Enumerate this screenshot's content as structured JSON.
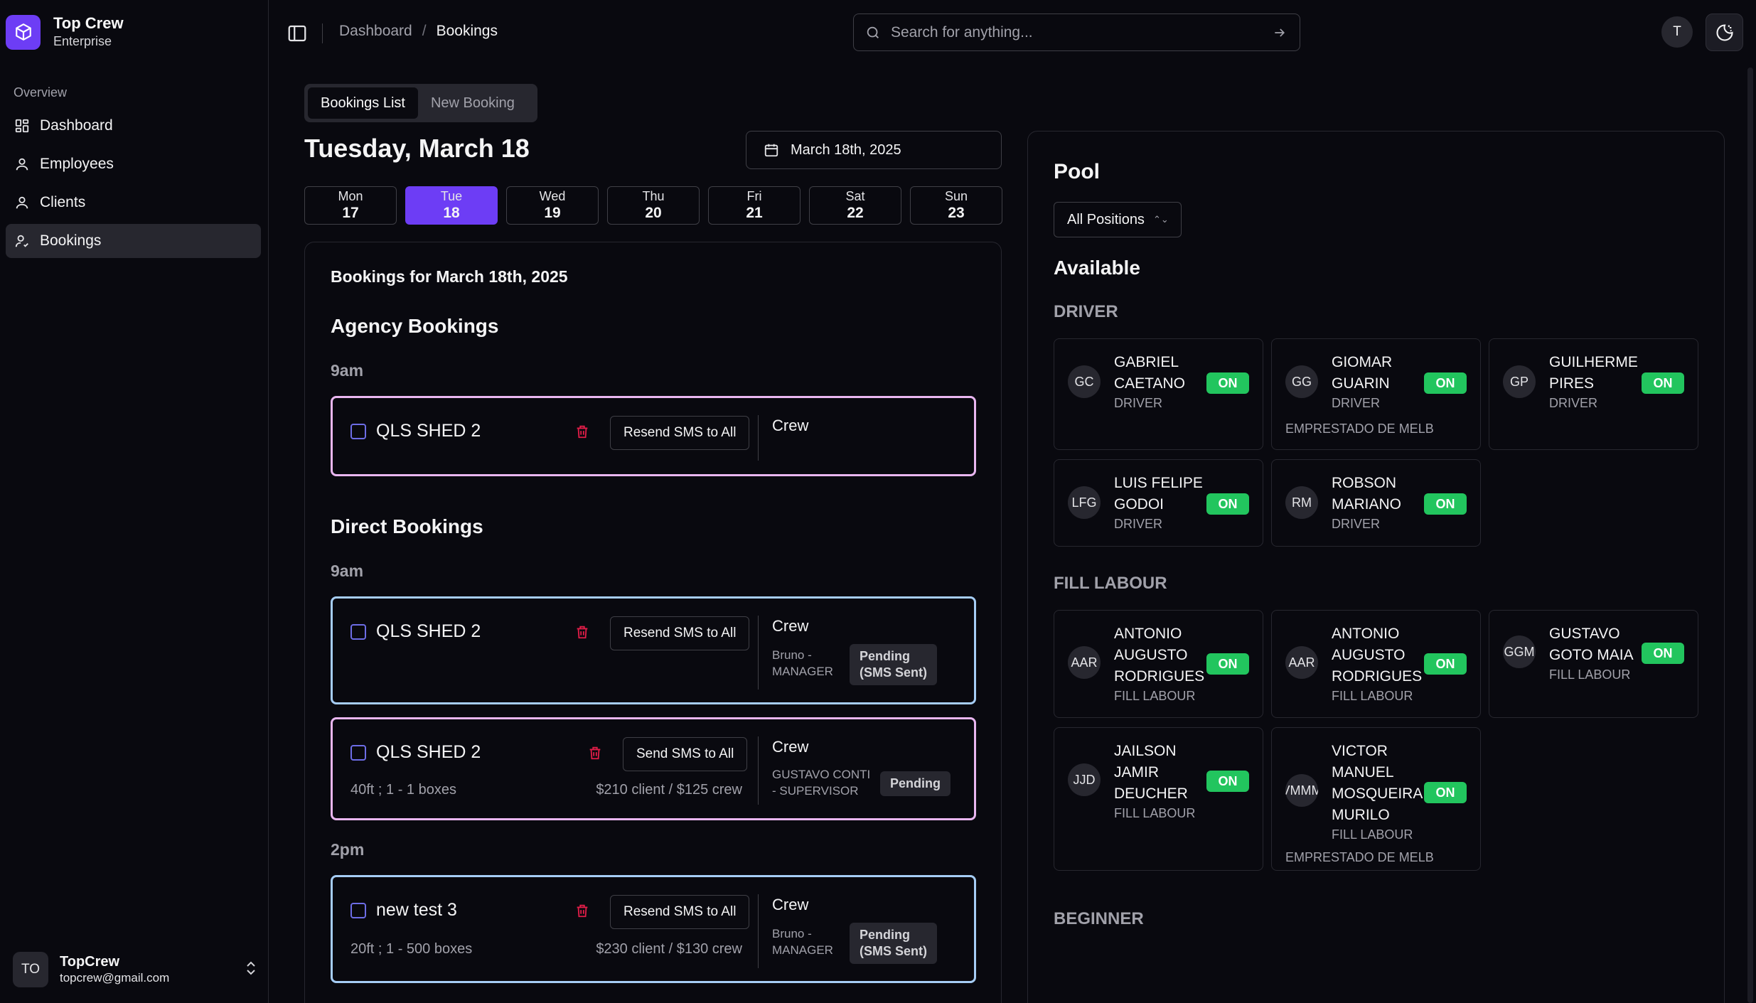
{
  "brand": {
    "name": "Top Crew",
    "plan": "Enterprise"
  },
  "sidebar": {
    "section": "Overview",
    "items": [
      {
        "label": "Dashboard",
        "icon": "dashboard-icon"
      },
      {
        "label": "Employees",
        "icon": "user-icon"
      },
      {
        "label": "Clients",
        "icon": "user-icon"
      },
      {
        "label": "Bookings",
        "icon": "user-check-icon",
        "active": true
      }
    ]
  },
  "user": {
    "initials": "TO",
    "name": "TopCrew",
    "email": "topcrew@gmail.com"
  },
  "topbar": {
    "breadcrumb": [
      "Dashboard",
      "Bookings"
    ],
    "search_placeholder": "Search for anything...",
    "avatar_initial": "T"
  },
  "tabs": {
    "list": "Bookings List",
    "new": "New Booking"
  },
  "date": {
    "title": "Tuesday, March 18",
    "picker": "March 18th, 2025"
  },
  "week": [
    {
      "name": "Mon",
      "num": "17"
    },
    {
      "name": "Tue",
      "num": "18",
      "active": true
    },
    {
      "name": "Wed",
      "num": "19"
    },
    {
      "name": "Thu",
      "num": "20"
    },
    {
      "name": "Fri",
      "num": "21"
    },
    {
      "name": "Sat",
      "num": "22"
    },
    {
      "name": "Sun",
      "num": "23"
    }
  ],
  "bookings": {
    "header": "Bookings for March 18th, 2025",
    "agency_title": "Agency Bookings",
    "direct_title": "Direct Bookings",
    "agency": [
      {
        "time": "9am",
        "name": "QLS SHED 2",
        "sms": "Resend SMS to All",
        "crew": "Crew"
      }
    ],
    "direct": [
      {
        "time": "9am",
        "name": "QLS SHED 2",
        "sms": "Resend SMS to All",
        "crew": "Crew",
        "person": [
          "Bruno -",
          "MANAGER"
        ],
        "status": [
          "Pending",
          "(SMS Sent)"
        ]
      },
      {
        "name": "QLS SHED 2",
        "sms": "Send SMS to All",
        "crew": "Crew",
        "sub": "40ft ; 1 - 1 boxes",
        "price": "$210 client / $125 crew",
        "person": [
          "GUSTAVO CONTI",
          "- SUPERVISOR"
        ],
        "status": [
          "Pending"
        ]
      },
      {
        "time": "2pm",
        "name": "new test 3",
        "sms": "Resend SMS to All",
        "crew": "Crew",
        "sub": "20ft ; 1 - 500 boxes",
        "price": "$230 client / $130 crew",
        "person": [
          "Bruno -",
          "MANAGER"
        ],
        "status": [
          "Pending",
          "(SMS Sent)"
        ]
      }
    ]
  },
  "pool": {
    "title": "Pool",
    "filter": "All Positions",
    "available": "Available",
    "categories": [
      {
        "title": "DRIVER",
        "employees": [
          {
            "initials": "GC",
            "name": "GABRIEL CAETANO",
            "role": "DRIVER",
            "status": "ON"
          },
          {
            "initials": "GG",
            "name": "GIOMAR GUARIN",
            "role": "DRIVER",
            "status": "ON",
            "extra": "EMPRESTADO DE MELB"
          },
          {
            "initials": "GP",
            "name": "GUILHERME PIRES",
            "role": "DRIVER",
            "status": "ON"
          },
          {
            "initials": "LFG",
            "name": "LUIS FELIPE GODOI",
            "role": "DRIVER",
            "status": "ON"
          },
          {
            "initials": "RM",
            "name": "ROBSON MARIANO",
            "role": "DRIVER",
            "status": "ON"
          }
        ]
      },
      {
        "title": "FILL LABOUR",
        "employees": [
          {
            "initials": "AAR",
            "name": "ANTONIO AUGUSTO RODRIGUES",
            "role": "FILL LABOUR",
            "status": "ON"
          },
          {
            "initials": "AAR",
            "name": "ANTONIO AUGUSTO RODRIGUES",
            "role": "FILL LABOUR",
            "status": "ON"
          },
          {
            "initials": "GGM",
            "name": "GUSTAVO GOTO MAIA",
            "role": "FILL LABOUR",
            "status": "ON"
          },
          {
            "initials": "JJD",
            "name": "JAILSON JAMIR DEUCHER",
            "role": "FILL LABOUR",
            "status": "ON"
          },
          {
            "initials": "VMMM",
            "name": "VICTOR MANUEL MOSQUEIRA MURILO",
            "role": "FILL LABOUR",
            "status": "ON",
            "extra": "EMPRESTADO DE MELB"
          }
        ]
      },
      {
        "title": "BEGINNER",
        "employees": []
      }
    ]
  },
  "colors": {
    "accent": "#6d3df5",
    "on": "#22c55e",
    "agency_border": "#e9b6f0",
    "direct_border": "#a6cdf5",
    "trash": "#e11d48"
  }
}
